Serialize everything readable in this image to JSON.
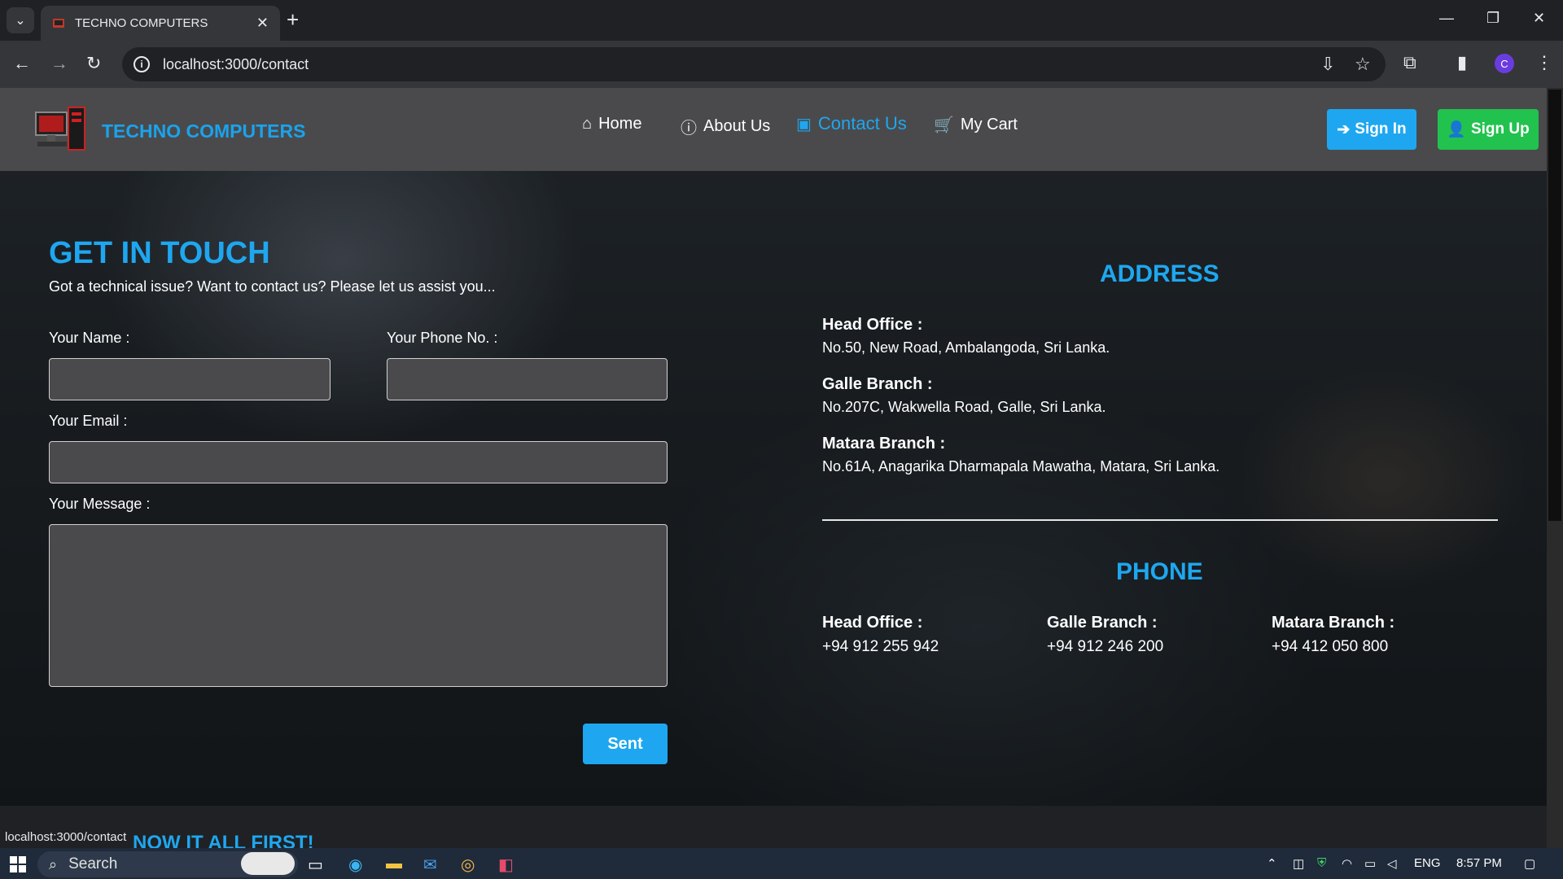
{
  "browser": {
    "tab_title": "TECHNO COMPUTERS",
    "url": "localhost:3000/contact",
    "status_url": "localhost:3000/contact",
    "profile_initial": "C"
  },
  "header": {
    "brand": "TECHNO COMPUTERS",
    "nav": [
      {
        "label": "Home",
        "icon": "home-icon"
      },
      {
        "label": "About Us",
        "icon": "info-icon"
      },
      {
        "label": "Contact Us",
        "icon": "contact-card-icon",
        "active": true
      },
      {
        "label": "My Cart",
        "icon": "cart-icon"
      }
    ],
    "signin_label": "Sign In",
    "signup_label": "Sign Up",
    "accent": "#1ea7f0",
    "signup_color": "#22c24f"
  },
  "contact_form": {
    "title": "GET IN TOUCH",
    "subtitle": "Got a technical issue? Want to contact us? Please let us assist you...",
    "name_label": "Your Name :",
    "name_value": "",
    "phone_label": "Your Phone No. :",
    "phone_value": "",
    "email_label": "Your Email :",
    "email_value": "",
    "message_label": "Your Message :",
    "message_value": "",
    "submit_label": "Sent"
  },
  "address": {
    "title": "ADDRESS",
    "entries": [
      {
        "label": "Head Office :",
        "text": "No.50, New Road, Ambalangoda, Sri Lanka."
      },
      {
        "label": "Galle Branch :",
        "text": "No.207C, Wakwella Road, Galle, Sri Lanka."
      },
      {
        "label": "Matara Branch :",
        "text": "No.61A, Anagarika Dharmapala Mawatha, Matara, Sri Lanka."
      }
    ]
  },
  "phone": {
    "title": "PHONE",
    "entries": [
      {
        "label": "Head Office :",
        "number": "+94 912 255 942"
      },
      {
        "label": "Galle Branch :",
        "number": "+94 912 246 200"
      },
      {
        "label": "Matara Branch :",
        "number": "+94 412 050 800"
      }
    ]
  },
  "below_fold_title": "NOW IT ALL FIRST!",
  "taskbar": {
    "search_placeholder": "Search",
    "language": "ENG",
    "time": "8:57 PM"
  }
}
